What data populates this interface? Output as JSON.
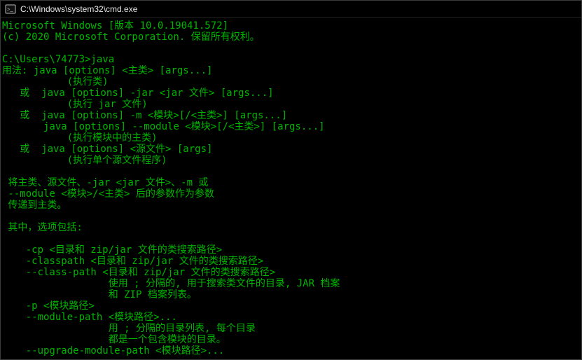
{
  "window": {
    "title": "C:\\Windows\\system32\\cmd.exe"
  },
  "terminal": {
    "lines": [
      "Microsoft Windows [版本 10.0.19041.572]",
      "(c) 2020 Microsoft Corporation. 保留所有权利。",
      "",
      "C:\\Users\\74773>java",
      "用法: java [options] <主类> [args...]",
      "           (执行类)",
      "   或  java [options] -jar <jar 文件> [args...]",
      "           (执行 jar 文件)",
      "   或  java [options] -m <模块>[/<主类>] [args...]",
      "       java [options] --module <模块>[/<主类>] [args...]",
      "           (执行模块中的主类)",
      "   或  java [options] <源文件> [args]",
      "           (执行单个源文件程序)",
      "",
      " 将主类、源文件、-jar <jar 文件>、-m 或",
      " --module <模块>/<主类> 后的参数作为参数",
      " 传递到主类。",
      "",
      " 其中，选项包括:",
      "",
      "    -cp <目录和 zip/jar 文件的类搜索路径>",
      "    -classpath <目录和 zip/jar 文件的类搜索路径>",
      "    --class-path <目录和 zip/jar 文件的类搜索路径>",
      "                  使用 ; 分隔的, 用于搜索类文件的目录, JAR 档案",
      "                  和 ZIP 档案列表。",
      "    -p <模块路径>",
      "    --module-path <模块路径>...",
      "                  用 ; 分隔的目录列表, 每个目录",
      "                  都是一个包含模块的目录。",
      "    --upgrade-module-path <模块路径>..."
    ]
  }
}
